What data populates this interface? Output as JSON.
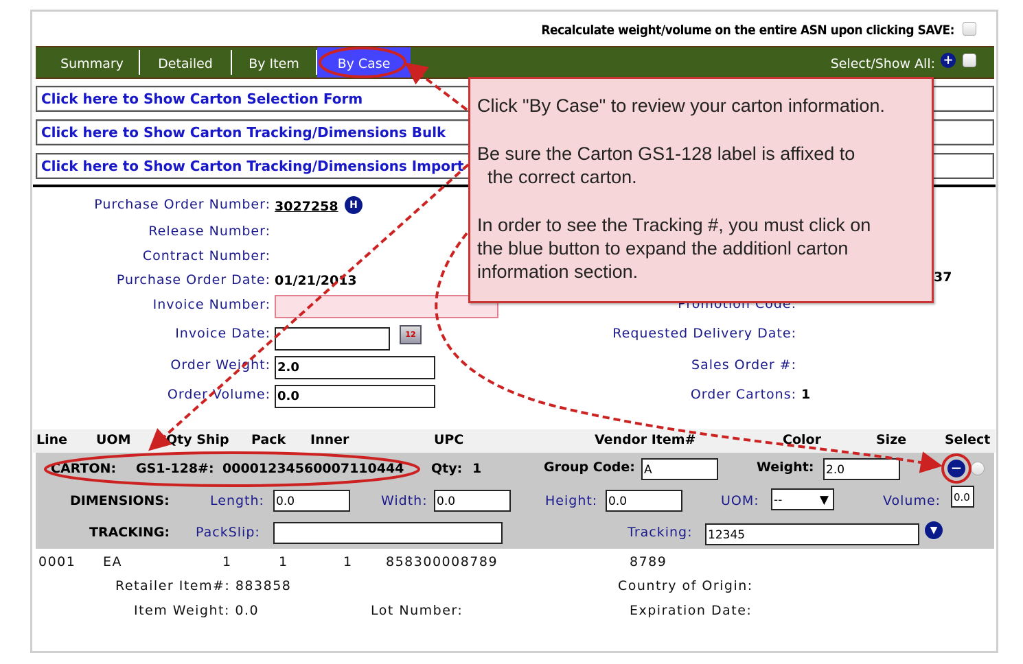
{
  "recalc_label": "Recalculate weight/volume on the entire ASN upon clicking SAVE:",
  "tabs": [
    {
      "label": "Summary"
    },
    {
      "label": "Detailed"
    },
    {
      "label": "By Item"
    },
    {
      "label": "By Case",
      "active": true
    }
  ],
  "select_show_all": "Select/Show All:",
  "links": [
    "Click here to Show Carton Selection Form",
    "Click here to Show Carton Tracking/Dimensions Bulk",
    "Click here to Show Carton Tracking/Dimensions Import"
  ],
  "form_left": {
    "po_number_label": "Purchase Order Number:",
    "po_number": "3027258",
    "release_label": "Release Number:",
    "contract_label": "Contract Number:",
    "po_date_label": "Purchase Order Date:",
    "po_date": "01/21/2013",
    "invoice_number_label": "Invoice Number:",
    "invoice_number": "",
    "invoice_date_label": "Invoice Date:",
    "invoice_date": "",
    "order_weight_label": "Order Weight:",
    "order_weight": "2.0",
    "order_volume_label": "Order Volume:",
    "order_volume": "0.0"
  },
  "form_right": {
    "partial_value": "37",
    "promotion_label": "Promotion Code:",
    "requested_delivery_label": "Requested Delivery Date:",
    "sales_order_label": "Sales Order #:",
    "order_cartons_label": "Order Cartons:",
    "order_cartons": "1"
  },
  "columns": [
    "Line",
    "UOM",
    "Qty Ship",
    "Pack",
    "Inner",
    "UPC",
    "Vendor Item#",
    "Color",
    "Size",
    "Select"
  ],
  "carton": {
    "carton_label": "CARTON:",
    "gs1_label": "GS1-128#:",
    "gs1": "00001234560007110444",
    "qty_label": "Qty:",
    "qty": "1",
    "group_code_label": "Group Code:",
    "group_code": "A",
    "weight_label": "Weight:",
    "weight": "2.0",
    "dimensions_label": "DIMENSIONS:",
    "length_label": "Length:",
    "length": "0.0",
    "width_label": "Width:",
    "width": "0.0",
    "height_label": "Height:",
    "height": "0.0",
    "uom_label": "UOM:",
    "uom": "--",
    "volume_label": "Volume:",
    "volume": "0.0",
    "tracking_row_label": "TRACKING:",
    "packslip_label": "PackSlip:",
    "packslip": "",
    "tracking_label": "Tracking:",
    "tracking": "12345"
  },
  "item": {
    "line": "0001",
    "uom": "EA",
    "qty_ship": "1",
    "pack": "1",
    "inner": "1",
    "upc": "858300008789",
    "vendor_item": "8789",
    "retailer_item": "Retailer Item#: 883858",
    "country": "Country of Origin:",
    "item_weight": "Item Weight: 0.0",
    "lot": "Lot Number:",
    "expiration": "Expiration Date:"
  },
  "callout": {
    "line1": "Click \"By Case\" to review your carton information.",
    "line2": "Be sure the Carton GS1-128 label is affixed to",
    "line3": "  the correct carton.",
    "line4": "In order to see the Tracking #, you must click on",
    "line5": "the blue button to expand the additionl carton",
    "line6": "information section."
  },
  "colors": {
    "tabbar": "#3f5f1d",
    "active_tab": "#4444ff",
    "callout_bg": "#f7d6d9",
    "annotation_red": "#cc2222",
    "label_blue": "#1a1a8c"
  }
}
